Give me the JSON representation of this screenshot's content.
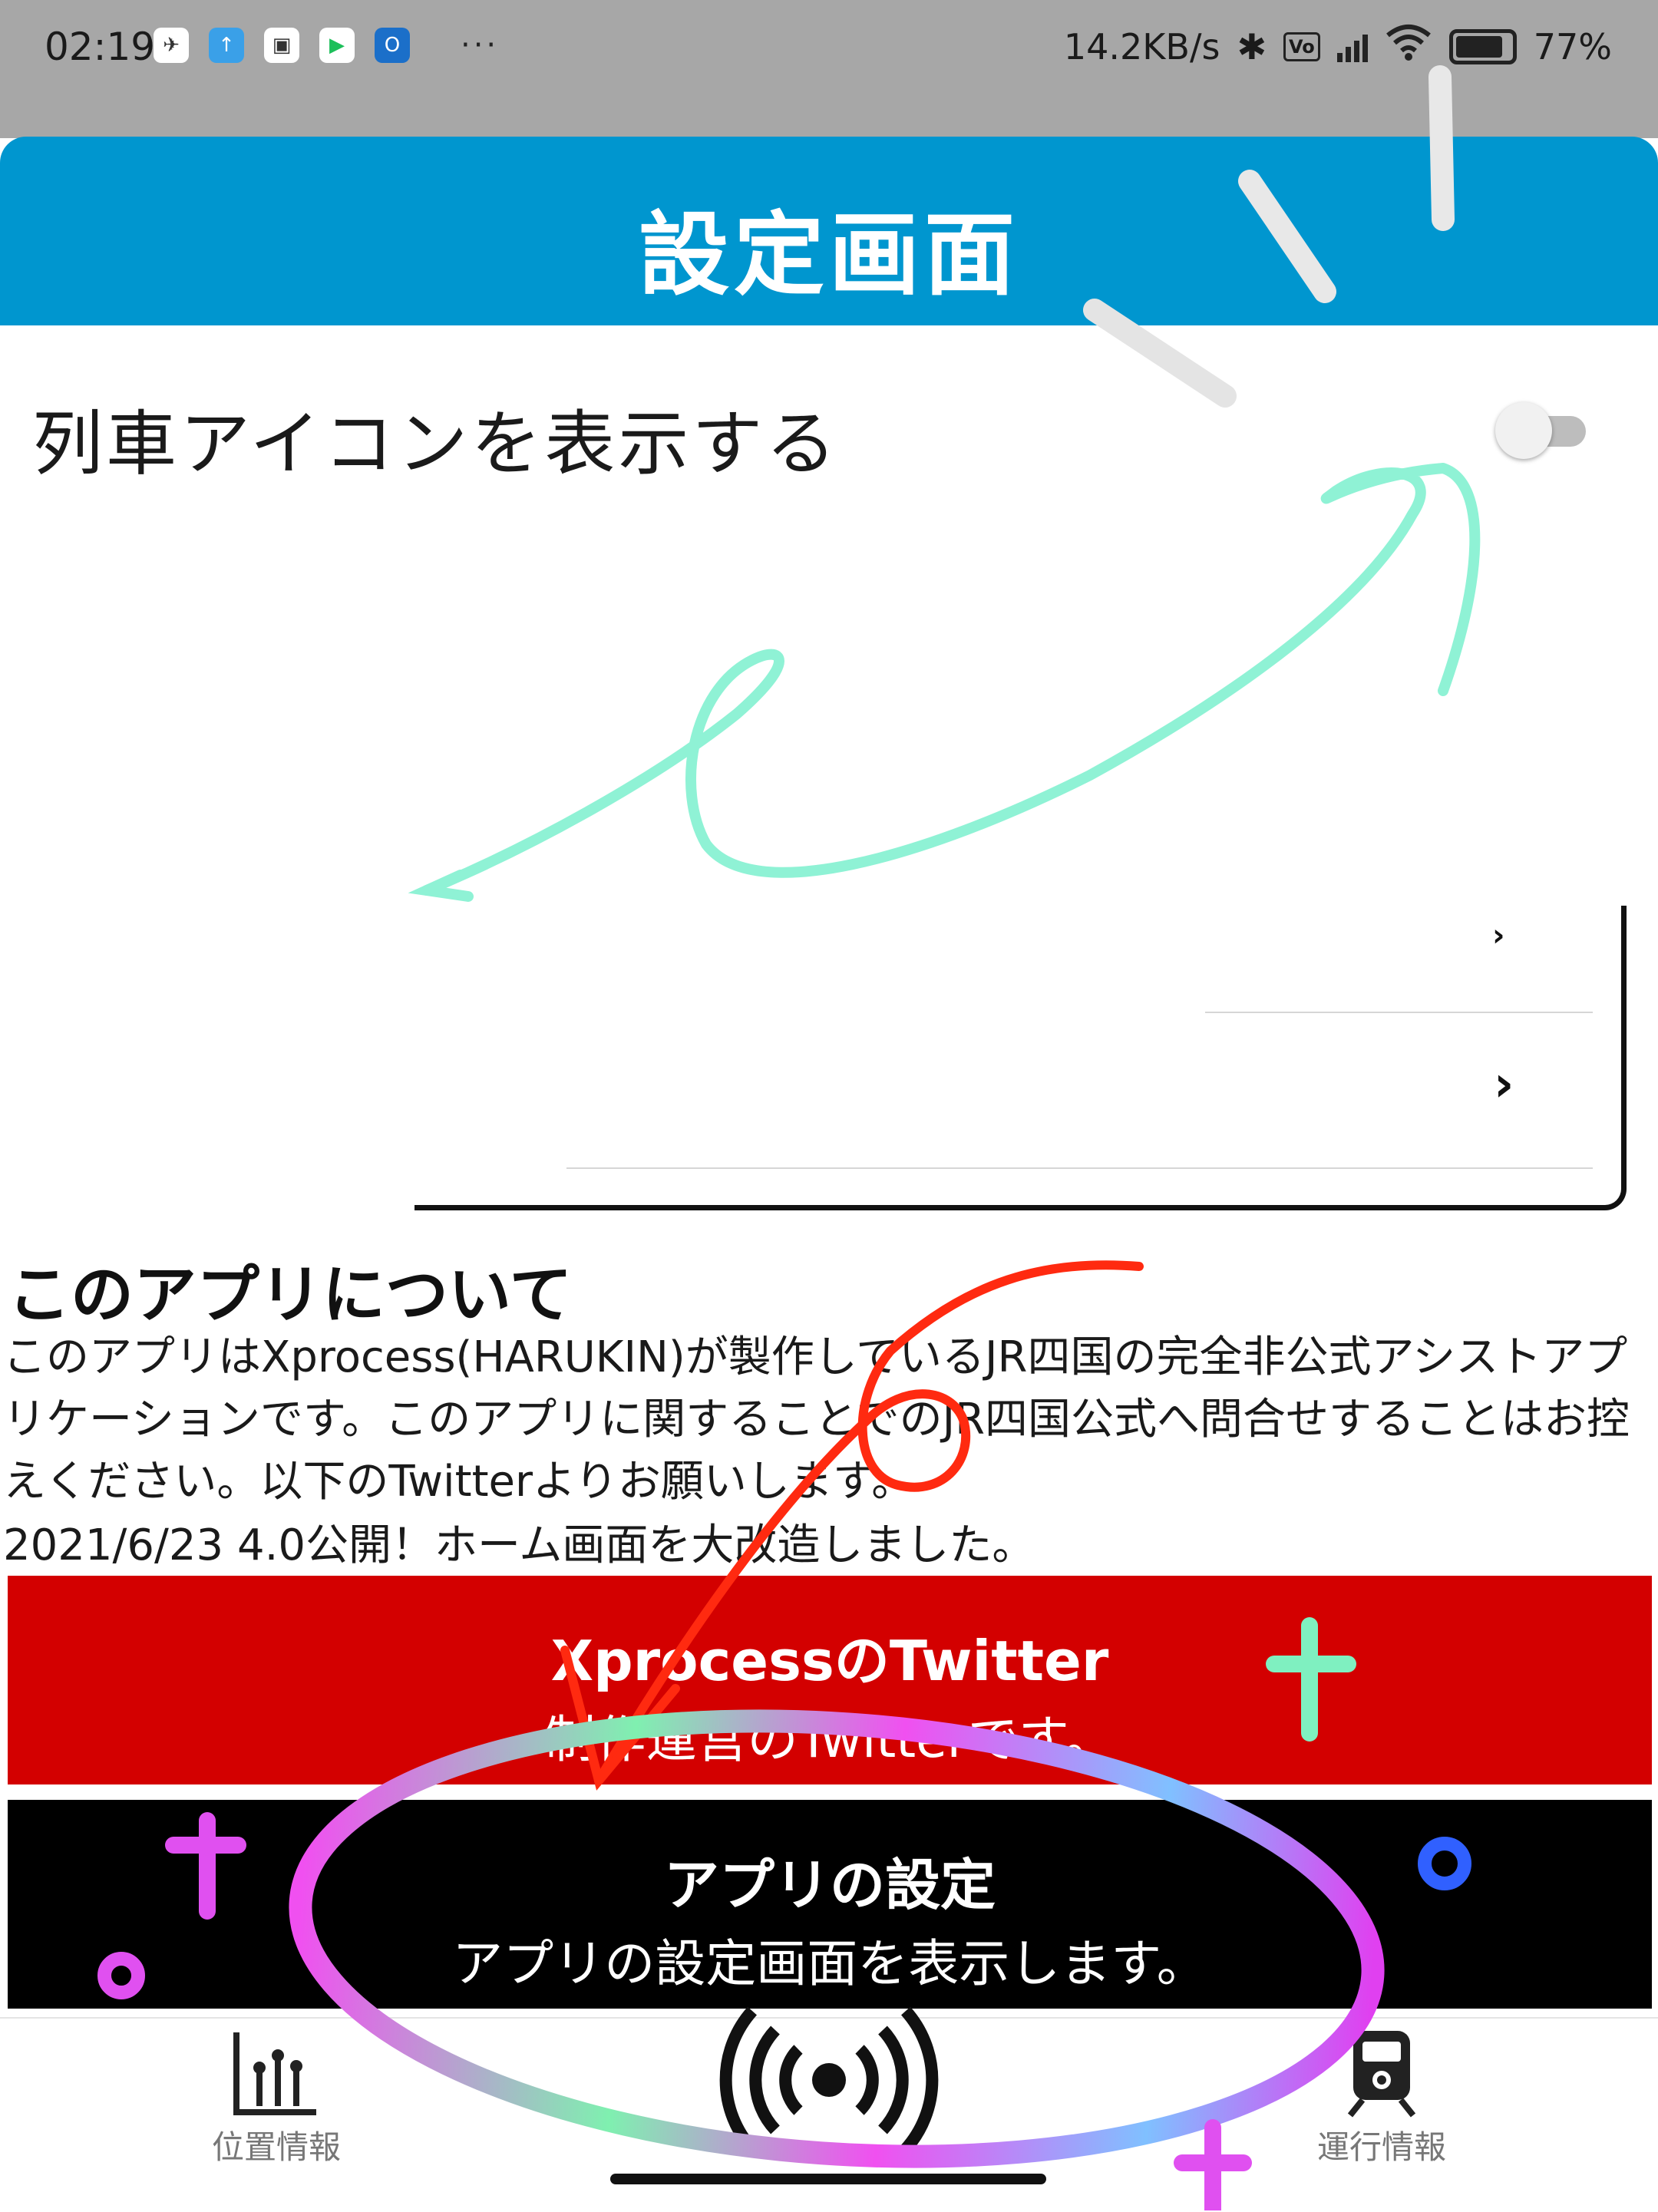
{
  "status_bar": {
    "time": "02:19",
    "more": "···",
    "net_speed": "14.2KB/s",
    "battery": "77%",
    "battery_level": 0.77
  },
  "app_bar": {
    "title": "設定画面"
  },
  "settings": {
    "train_icon_label": "列車アイコンを表示する",
    "train_icon_enabled": false
  },
  "about": {
    "title": "このアプリについて",
    "description": "このアプリはXprocess(HARUKIN)が製作しているJR四国の完全非公式アシストアプリケーションです。このアプリに関することでのJR四国公式へ問合せすることはお控えください。以下のTwitterよりお願いします。",
    "update_note": "2021/6/23 4.0公開！ホーム画面を大改造しました。"
  },
  "buttons": {
    "twitter_title": "XprocessのTwitter",
    "twitter_subtitle": "制作運営のTwitterです。",
    "settings_title": "アプリの設定",
    "settings_subtitle": "アプリの設定画面を表示します。"
  },
  "bottom_nav": {
    "items": [
      {
        "label": "位置情報",
        "icon": "bar-chart-icon"
      },
      {
        "label": "",
        "icon": "broadcast-icon"
      },
      {
        "label": "運行情報",
        "icon": "train-icon"
      }
    ]
  },
  "colors": {
    "app_bar": "#0096cf",
    "twitter_button": "#d30000",
    "settings_button": "#000000",
    "annotation_teal": "#8ff2d5",
    "annotation_red": "#ff2a10",
    "annotation_magenta": "#f050f0"
  }
}
